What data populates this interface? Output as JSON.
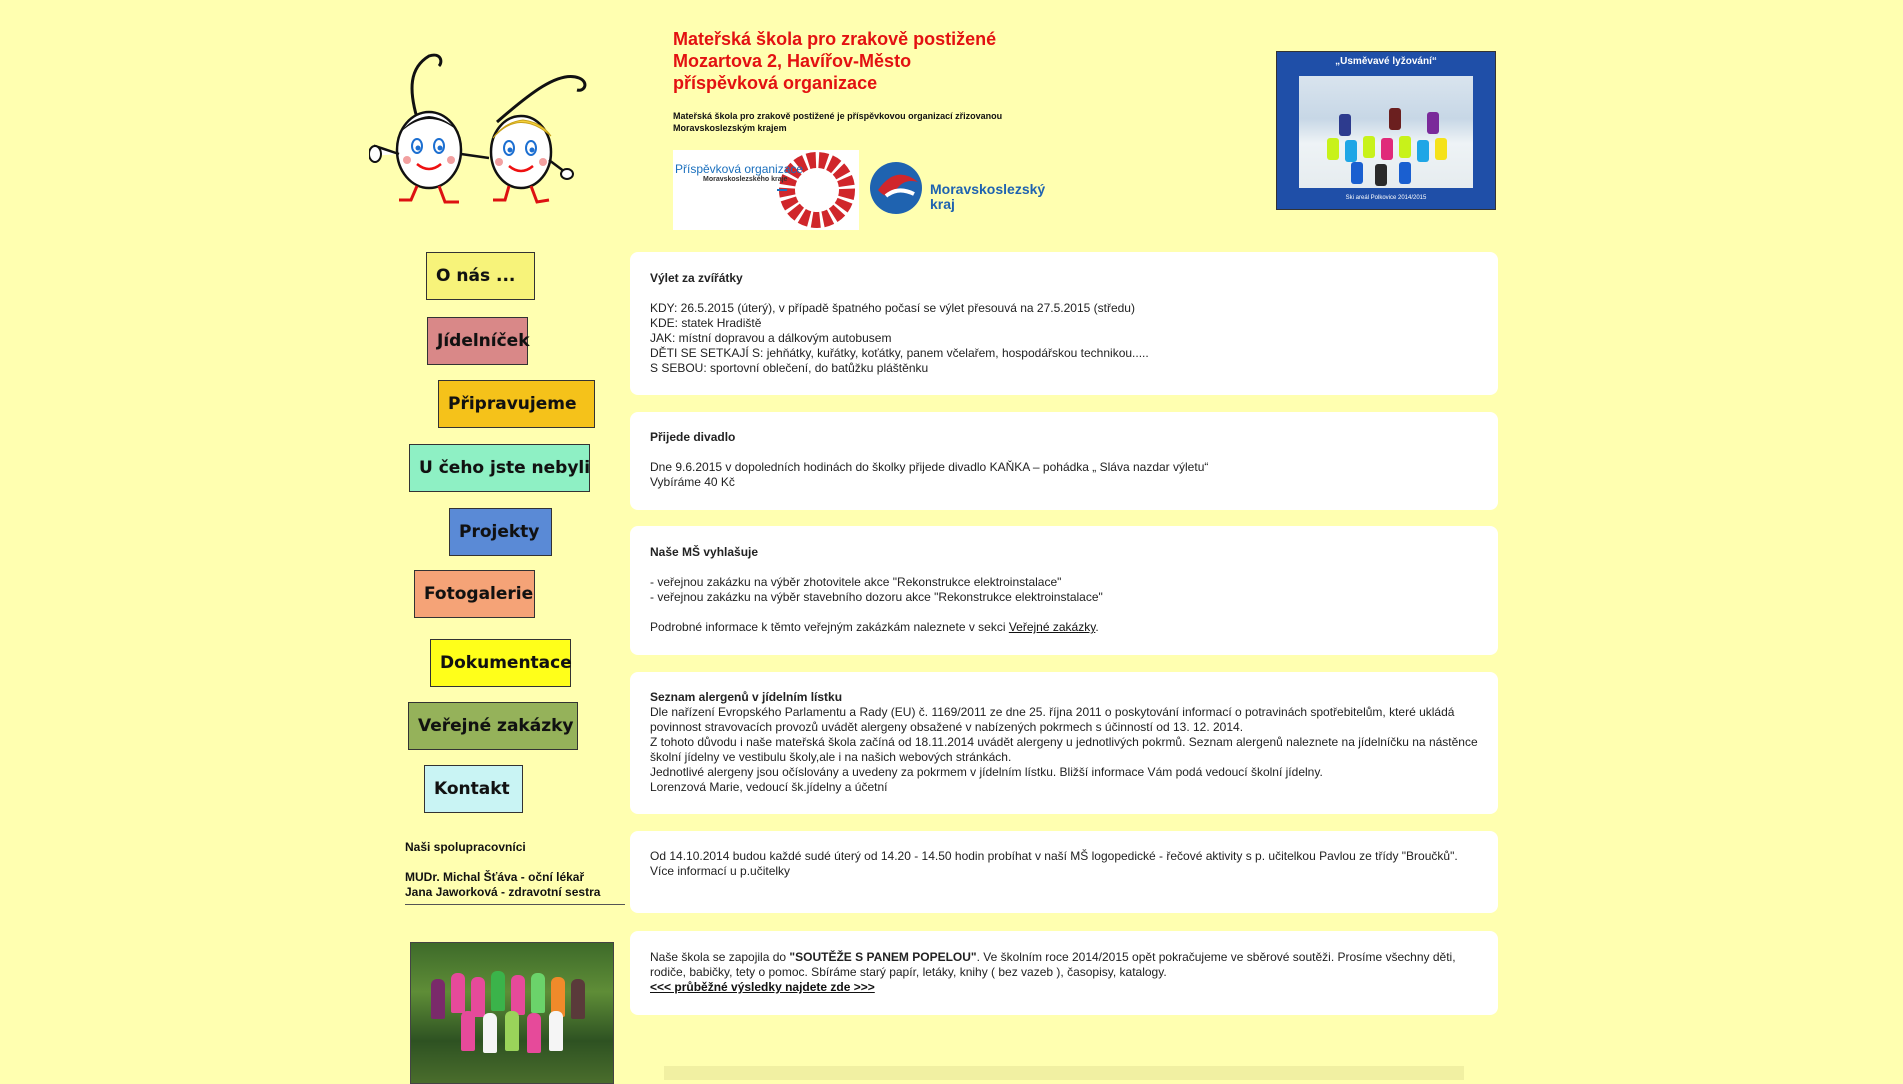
{
  "header": {
    "school_name": [
      "Mateřská škola pro zrakově postižené",
      "Mozartova 2, Havířov-Město",
      "příspěvková organizace"
    ],
    "description": "Mateřská škola pro zrakově postižené je příspěvkovou organizací zřizovanou Moravskoslezským krajem",
    "badge_org": {
      "title": "Příspěvková organizace",
      "subtitle": "Moravskoslezského kraje"
    },
    "badge_region": {
      "line1": "Moravskoslezský",
      "line2": "kraj"
    },
    "ski_photo": {
      "title": "„Usměvavé lyžování“",
      "caption": "Ski areál Polkovice 2014/2015"
    }
  },
  "nav": [
    {
      "label": "O nás ...",
      "color": "#f7f37a"
    },
    {
      "label": "Jídelníček",
      "color": "#d98888"
    },
    {
      "label": "Připravujeme",
      "color": "#f5c21a"
    },
    {
      "label": "U čeho jste nebyli",
      "color": "#8ef0c4"
    },
    {
      "label": "Projekty",
      "color": "#5a8ad6"
    },
    {
      "label": "Fotogalerie",
      "color": "#f5a377"
    },
    {
      "label": "Dokumentace",
      "color": "#ffff1a"
    },
    {
      "label": "Veřejné zakázky",
      "color": "#95b25a"
    },
    {
      "label": "Kontakt",
      "color": "#c9f4f4"
    }
  ],
  "partners": {
    "heading": "Naši spolupracovníci",
    "items": [
      "MUDr. Michal Šťáva - oční lékař",
      "Jana Jaworková - zdravotní sestra"
    ]
  },
  "news": [
    {
      "title": "Výlet za zvířátky",
      "lines": [
        "KDY: 26.5.2015 (úterý), v případě špatného počasí se výlet přesouvá na 27.5.2015 (středu)",
        "KDE: statek Hradiště",
        "JAK: místní dopravou a dálkovým autobusem",
        "DĚTI SE SETKAJÍ S: jehňátky, kuřátky, koťátky, panem včelařem, hospodářskou technikou.....",
        "S SEBOU: sportovní oblečení, do batůžku pláštěnku"
      ]
    },
    {
      "title": "Přijede divadlo",
      "lines": [
        "Dne 9.6.2015 v dopoledních hodinách do školky přijede divadlo KAŇKA – pohádka „ Sláva nazdar výletu“",
        "Vybíráme 40 Kč"
      ]
    },
    {
      "title": "Naše MŠ vyhlašuje",
      "lines": [
        "- veřejnou zakázku na výběr zhotovitele akce \"Rekonstrukce elektroinstalace\"",
        "- veřejnou zakázku na výběr stavebního dozoru akce \"Rekonstrukce elektroinstalace\""
      ],
      "info_prefix": "Podrobné informace k těmto veřejným zakázkám naleznete v sekci ",
      "info_link": "Veřejné zakázky",
      "info_suffix": "."
    },
    {
      "title": "Seznam alergenů v jídelním lístku",
      "lines": [
        "Dle nařízení Evropského Parlamentu a Rady (EU) č. 1169/2011 ze dne 25. října 2011 o poskytování informací o potravinách spotřebitelům, které ukládá povinnost stravovacích provozů uvádět alergeny obsažené v nabízených pokrmech s účinností od 13. 12. 2014.",
        "Z tohoto důvodu i naše mateřská škola začíná od 18.11.2014 uvádět alergeny u jednotlivých pokrmů. Seznam alergenů naleznete na jídelníčku na nástěnce školní jídelny ve vestibulu školy,ale i na našich webových stránkách.",
        "Jednotlivé alergeny jsou očíslovány a uvedeny za pokrmem v jídelním lístku. Bližší informace Vám podá vedoucí školní jídelny.",
        "Lorenzová Marie, vedoucí šk.jídelny a účetní"
      ]
    },
    {
      "lines": [
        "Od 14.10.2014 budou každé sudé úterý od 14.20 - 14.50 hodin probíhat v naší MŠ logopedické - řečové aktivity s p. učitelkou Pavlou ze třídy \"Broučků\".",
        "Více informací u p.učitelky"
      ]
    },
    {
      "text_before": "Naše škola se zapojila do ",
      "highlight": "\"SOUTĚŽE S PANEM POPELOU\"",
      "text_after": ". Ve školním roce 2014/2015 opět pokračujeme ve sběrové soutěži. Prosíme všechny děti, rodiče, babičky, tety o pomoc. Sbíráme starý papír, letáky, knihy ( bez vazeb ), časopisy, katalogy.",
      "link": "<<< průběžné výsledky najdete zde >>>"
    }
  ]
}
